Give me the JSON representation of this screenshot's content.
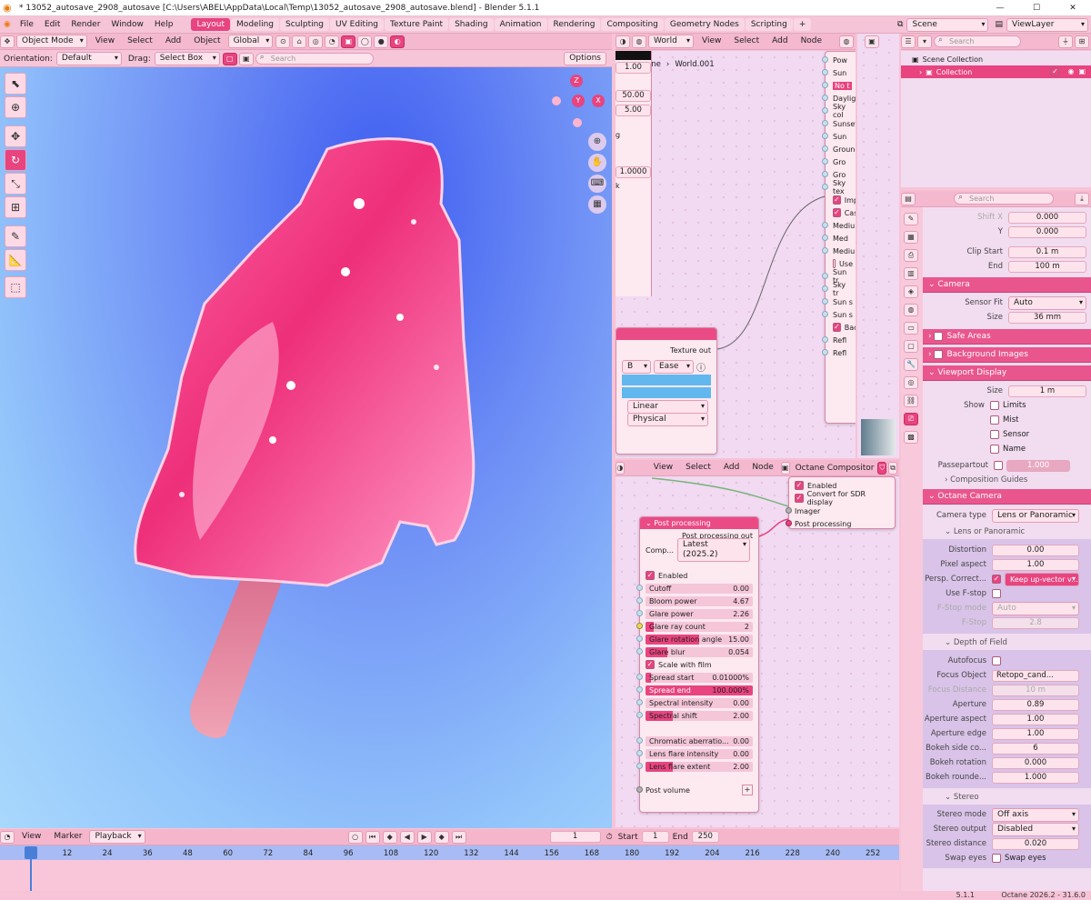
{
  "titlebar": {
    "title": "* 13052_autosave_2908_autosave [C:\\Users\\ABEL\\AppData\\Local\\Temp\\13052_autosave_2908_autosave.blend] - Blender 5.1.1"
  },
  "menu": {
    "items": [
      "File",
      "Edit",
      "Render",
      "Window",
      "Help"
    ]
  },
  "workspaces": {
    "tabs": [
      "Layout",
      "Modeling",
      "Sculpting",
      "UV Editing",
      "Texture Paint",
      "Shading",
      "Animation",
      "Rendering",
      "Compositing",
      "Geometry Nodes",
      "Scripting"
    ],
    "active": "Layout",
    "add": "+"
  },
  "scene": {
    "label": "Scene",
    "viewlayer": "ViewLayer"
  },
  "viewport": {
    "mode": "Object Mode",
    "view": "View",
    "select": "Select",
    "add": "Add",
    "object": "Object",
    "orientation_value": "Global",
    "orientation_label": "Orientation:",
    "orientation_default": "Default",
    "drag_label": "Drag:",
    "drag_value": "Select Box",
    "search_placeholder": "Search",
    "options": "Options",
    "gizmo": {
      "z": "Z",
      "y": "Y",
      "x": "X"
    }
  },
  "shader_editor": {
    "world_label": "World",
    "view": "View",
    "select": "Select",
    "add": "Add",
    "node": "Node",
    "breadcrumb_scene": "Scene",
    "breadcrumb_world": "World.001",
    "values": [
      "1.00",
      "50.00",
      "5.00",
      "1.0000"
    ],
    "partial_labels": [
      "g",
      "k"
    ],
    "texture_out": "Texture out",
    "ease_prefix": "B",
    "ease": "Ease",
    "linear": "Linear",
    "physical": "Physical",
    "daylight_rows": [
      "Pow",
      "Sun",
      "No t",
      "Daylight",
      "Sky col",
      "Sunset",
      "Sun",
      "Ground",
      "Gro",
      "Gro",
      "Sky tex",
      "Imp",
      "Cas",
      "Medium",
      "Med",
      "Medium",
      "Use",
      "Sun tr",
      "Sky tr",
      "Sun s",
      "Sun s",
      "Back",
      "Refl",
      "Refl"
    ]
  },
  "outliner": {
    "search_placeholder": "Search",
    "scene_collection": "Scene Collection",
    "collection": "Collection"
  },
  "properties": {
    "search_placeholder": "Search",
    "top_rows": [
      {
        "label": "Shift X",
        "value": "0.000"
      },
      {
        "label": "Y",
        "value": "0.000"
      },
      {
        "label": "Clip Start",
        "value": "0.1 m"
      },
      {
        "label": "End",
        "value": "100 m"
      }
    ],
    "camera_section": "Camera",
    "sensor_fit_label": "Sensor Fit",
    "sensor_fit": "Auto",
    "size_label": "Size",
    "size": "36 mm",
    "safe_areas": "Safe Areas",
    "background_images": "Background Images",
    "viewport_display": "Viewport Display",
    "vd_size_label": "Size",
    "vd_size": "1 m",
    "show_label": "Show",
    "show_items": [
      "Limits",
      "Mist",
      "Sensor",
      "Name"
    ],
    "passepartout_label": "Passepartout",
    "passepartout": "1.000",
    "composition_guides": "Composition Guides",
    "octane_camera": "Octane Camera",
    "camera_type_label": "Camera type",
    "camera_type": "Lens or Panoramic",
    "lens_section": "Lens or Panoramic",
    "lens_rows": [
      {
        "label": "Distortion",
        "value": "0.00"
      },
      {
        "label": "Pixel aspect",
        "value": "1.00"
      }
    ],
    "persp_label": "Persp. Correct...",
    "persp_value": "Keep up-vector v...",
    "use_fstop_label": "Use F-stop",
    "fstop_mode_label": "F-Stop mode",
    "fstop_mode": "Auto",
    "fstop_label": "F-Stop",
    "fstop": "2.8",
    "dof_section": "Depth of Field",
    "autofocus_label": "Autofocus",
    "focus_object_label": "Focus Object",
    "focus_object": "Retopo_cand...",
    "focus_distance_label": "Focus Distance",
    "focus_distance": "10 m",
    "dof_rows": [
      {
        "label": "Aperture",
        "value": "0.89"
      },
      {
        "label": "Aperture aspect",
        "value": "1.00"
      },
      {
        "label": "Aperture edge",
        "value": "1.00"
      },
      {
        "label": "Bokeh side co...",
        "value": "6"
      },
      {
        "label": "Bokeh rotation",
        "value": "0.000"
      },
      {
        "label": "Bokeh rounde...",
        "value": "1.000"
      }
    ],
    "stereo_section": "Stereo",
    "stereo_mode_label": "Stereo mode",
    "stereo_mode": "Off axis",
    "stereo_output_label": "Stereo output",
    "stereo_output": "Disabled",
    "stereo_distance_label": "Stereo distance",
    "stereo_distance": "0.020",
    "swap_eyes_label": "Swap eyes",
    "swap_eyes": "Swap eyes"
  },
  "compositor": {
    "view": "View",
    "select": "Select",
    "add": "Add",
    "node": "Node",
    "name": "Octane Compositor",
    "imager_rows": [
      "Enabled",
      "Convert for SDR display",
      "Imager",
      "Post processing"
    ],
    "post_node_title": "Post processing",
    "post_out": "Post processing out",
    "comp_label": "Comp...",
    "comp_value": "Latest (2025.2)",
    "enabled": "Enabled",
    "rows": [
      {
        "label": "Cutoff",
        "value": "0.00",
        "fill": 0
      },
      {
        "label": "Bloom power",
        "value": "4.67",
        "fill": 0
      },
      {
        "label": "Glare power",
        "value": "2.26",
        "fill": 0
      },
      {
        "label": "Glare ray count",
        "value": "2",
        "fill": 0.08
      },
      {
        "label": "Glare rotation angle",
        "value": "15.00",
        "fill": 0.5
      },
      {
        "label": "Glare blur",
        "value": "0.054",
        "fill": 0.2
      }
    ],
    "scale_with_film": "Scale with film",
    "rows2": [
      {
        "label": "Spread start",
        "value": "0.01000%",
        "fill": 0.05
      },
      {
        "label": "Spread end",
        "value": "100.000%",
        "fill": 1
      },
      {
        "label": "Spectral intensity",
        "value": "0.00",
        "fill": 0
      },
      {
        "label": "Spectral shift",
        "value": "2.00",
        "fill": 0.25
      }
    ],
    "rows3": [
      {
        "label": "Chromatic aberratio...",
        "value": "0.00",
        "fill": 0
      },
      {
        "label": "Lens flare intensity",
        "value": "0.00",
        "fill": 0
      },
      {
        "label": "Lens flare extent",
        "value": "2.00",
        "fill": 0.25
      }
    ],
    "post_volume": "Post volume"
  },
  "timeline": {
    "view": "View",
    "marker": "Marker",
    "playback": "Playback",
    "current_frame": "1",
    "start_label": "Start",
    "start": "1",
    "end_label": "End",
    "end": "250",
    "ticks": [
      "1",
      "12",
      "24",
      "36",
      "48",
      "60",
      "72",
      "84",
      "96",
      "108",
      "120",
      "132",
      "144",
      "156",
      "168",
      "180",
      "192",
      "204",
      "216",
      "228",
      "240",
      "252"
    ]
  },
  "status": {
    "version": "5.1.1",
    "octane": "Octane 2026.2 - 31.6.0"
  }
}
